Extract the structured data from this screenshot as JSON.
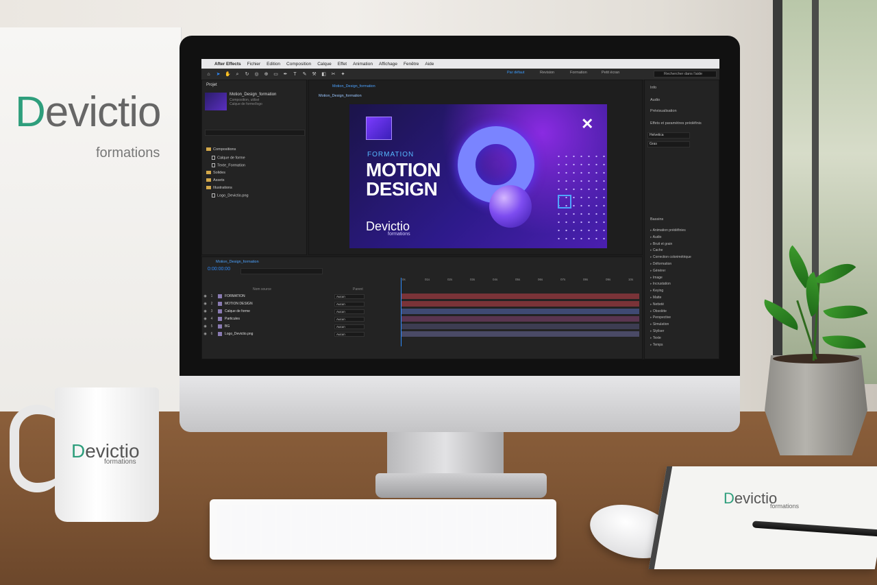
{
  "banner": {
    "logo_a": "D",
    "logo_b": "evictio",
    "sub": "formations"
  },
  "menubar": {
    "app": "After Effects",
    "items": [
      "Fichier",
      "Edition",
      "Composition",
      "Calque",
      "Effet",
      "Animation",
      "Affichage",
      "Fenêtre",
      "Aide"
    ]
  },
  "toolbar": {
    "workspaces": [
      "Par défaut",
      "Revision",
      "Formation",
      "Petit écran"
    ],
    "help_placeholder": "Rechercher dans l'aide"
  },
  "project": {
    "title": "Projet",
    "comp_name": "Motion_Design_formation",
    "meta_line1": "Composition, utilisé",
    "meta_line2": "Calque de forme/logo",
    "tree": [
      {
        "type": "folder",
        "label": "Compositions"
      },
      {
        "type": "file",
        "label": "Calque de forme"
      },
      {
        "type": "file",
        "label": "Texte_Formation"
      },
      {
        "type": "folder",
        "label": "Solides"
      },
      {
        "type": "folder",
        "label": "Assets"
      },
      {
        "type": "folder",
        "label": "Illustrations"
      },
      {
        "type": "file",
        "label": "Logo_Devictio.png"
      }
    ]
  },
  "composition": {
    "tab": "Motion_Design_formation",
    "sub_tab": "Motion_Design_formation",
    "tag": "FORMATION",
    "title_line1": "MOTION",
    "title_line2": "DESIGN",
    "logo": "Devictio",
    "logo_sub": "formations",
    "close_glyph": "✕"
  },
  "right_panel": {
    "items": [
      "Info",
      "Audio",
      "Prévisualisation",
      "Effets et paramètres prédéfinis"
    ],
    "font_name": "Helvetica",
    "font_style": "Gras",
    "effects_header": "Bassins",
    "effects": [
      "Animation prédéfinies",
      "Audio",
      "Bruit et grain",
      "Cache",
      "Correction colorimétrique",
      "Déformation",
      "Générer",
      "Image",
      "Incrustation",
      "Keying",
      "Matte",
      "Netteté",
      "Obsolète",
      "Perspective",
      "Simulation",
      "Styliser",
      "Texte",
      "Temps"
    ]
  },
  "timeline": {
    "tab": "Motion_Design_formation",
    "timecode": "0:00:00:00",
    "col_name": "Nom source",
    "col_mode": "Parent",
    "ruler": [
      "0s",
      "01s",
      "02s",
      "03s",
      "04s",
      "05s",
      "06s",
      "07s",
      "08s",
      "09s",
      "10s"
    ],
    "layers": [
      {
        "num": "1",
        "name": "FORMATION",
        "mode": "Aucun",
        "color": "#8a7bb3"
      },
      {
        "num": "2",
        "name": "MOTION DESIGN",
        "mode": "Aucun",
        "color": "#8a7bb3"
      },
      {
        "num": "3",
        "name": "Calque de forme",
        "mode": "Aucun",
        "color": "#8a7bb3"
      },
      {
        "num": "4",
        "name": "Particules",
        "mode": "Aucun",
        "color": "#8a7bb3"
      },
      {
        "num": "5",
        "name": "BG",
        "mode": "Aucun",
        "color": "#8a7bb3"
      },
      {
        "num": "6",
        "name": "Logo_Devictio.png",
        "mode": "Aucun",
        "color": "#8a7bb3"
      }
    ],
    "track_colors": [
      "#7a3338",
      "#7a3338",
      "#3f4a73",
      "#5a3550",
      "#3d3d52",
      "#4a4a66"
    ]
  },
  "mug": {
    "logo_a": "D",
    "logo_b": "evictio",
    "sub": "formations"
  },
  "notebook": {
    "logo_a": "D",
    "logo_b": "evictio",
    "sub": "formations"
  },
  "colors": {
    "accent": "#2f8cff",
    "brand_green": "#2e9e7c",
    "purple": "#4b1fb0"
  }
}
